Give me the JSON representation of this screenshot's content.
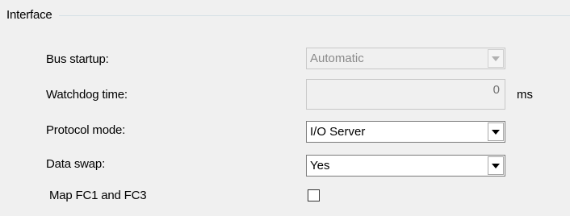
{
  "group": {
    "title": "Interface"
  },
  "rows": {
    "bus_startup": {
      "label": "Bus startup:",
      "value": "Automatic",
      "enabled": false
    },
    "watchdog_time": {
      "label": "Watchdog time:",
      "value": "0",
      "unit": "ms",
      "enabled": false
    },
    "protocol_mode": {
      "label": "Protocol mode:",
      "value": "I/O Server",
      "enabled": true
    },
    "data_swap": {
      "label": "Data swap:",
      "value": "Yes",
      "enabled": true
    },
    "map_fc1_fc3": {
      "label": "Map FC1 and FC3",
      "checked": false
    }
  },
  "icons": {
    "dropdown": "chevron-down-icon"
  },
  "colors": {
    "background": "#f0f0f0",
    "field_border": "#7a7a7a",
    "disabled_text": "#8a8a8a"
  }
}
